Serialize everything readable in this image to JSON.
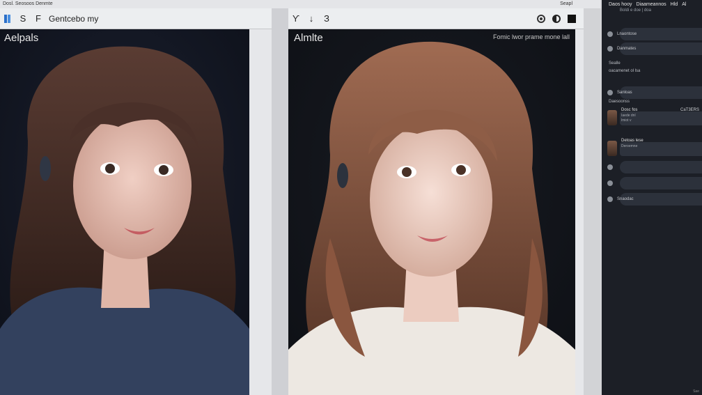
{
  "topbar": {
    "left_text": "Dosl. Seosoos Denmte",
    "right_text": "Seapl"
  },
  "left_pane": {
    "toolbar": {
      "icons": [
        "book-icon",
        "s-icon",
        "f-icon"
      ],
      "label": "Gentcebo my"
    },
    "photo": {
      "title": "Aelpals",
      "subject": "portrait, dark hair, navy sweater"
    }
  },
  "right_pane": {
    "toolbar": {
      "icons": [
        "pin-icon",
        "down-arrow-icon",
        "number-three-icon",
        "circle-icon",
        "contrast-icon",
        "square-icon"
      ],
      "letters": [
        "Ƴ",
        "↓",
        "З"
      ]
    },
    "photo": {
      "title": "Almlte",
      "note": "Fomic lwor prame mone lall"
    }
  },
  "sidebar": {
    "header": [
      "Daos hooy",
      "Diaameannos",
      "Hld",
      "Al"
    ],
    "sub": "Boldi e doe | doa",
    "items": [
      {
        "label": "Lnaontose"
      },
      {
        "label": "Danmates"
      }
    ],
    "plain1": "Sealle",
    "plain2": "oacamenet ol lsa",
    "plain3": "Sanloas",
    "plain4": "Daesoonss",
    "cards": [
      {
        "title": "Dosc fos",
        "sub": "Iaede dnl",
        "sub2": "lmiot v",
        "right": "CaT3ERS"
      },
      {
        "title": "Detoas lese",
        "sub": "Deroemne",
        "right": ""
      }
    ],
    "items2": [
      {
        "label": ""
      },
      {
        "label": ""
      },
      {
        "label": "Snaodac"
      }
    ],
    "footer": "Sae"
  },
  "colors": {
    "sidebar_bg": "#1c1f26",
    "pane_bg": "#e6e7ea",
    "photo_bg": "#13161d"
  }
}
